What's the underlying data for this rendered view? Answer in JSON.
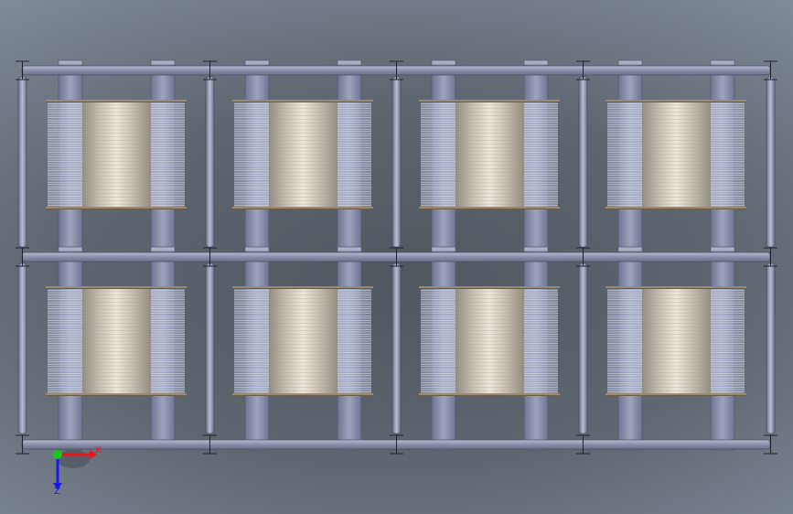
{
  "viewport": {
    "background_colors": [
      "#50575f",
      "#5e6670",
      "#7b8591",
      "#8e98a5"
    ]
  },
  "model": {
    "grid": {
      "rows": 2,
      "columns": 4
    },
    "frame_color": "#8d93ad",
    "spool_color": "#d8cfbf",
    "fin_color": "#c6cde0"
  },
  "triad": {
    "x_label": "X",
    "z_label": "Z",
    "x_color": "#e8141c",
    "y_color": "#18c818",
    "z_color": "#1a1ae8"
  }
}
